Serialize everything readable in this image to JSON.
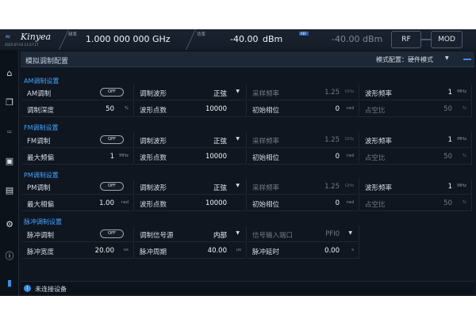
{
  "header": {
    "logo_text": "Kinyea",
    "date": "2025-07-03 11:57:17",
    "freq_label": "频率",
    "freq_value": "1.000 000 000",
    "freq_unit": "GHz",
    "power_label": "功率",
    "power_value": "-40.00",
    "power_unit": "dBm",
    "ref_badge": "REF",
    "power2_value": "-40.00 dBm",
    "rf_label": "RF",
    "mod_label": "MOD"
  },
  "sidebar": {
    "icons": [
      "home-icon",
      "window-icon",
      "scpi-icon",
      "monitor-icon",
      "document-icon",
      "gear-icon",
      "info-icon",
      "brand-icon"
    ]
  },
  "page": {
    "title": "模拟调制配置",
    "mode_label": "模式配置：硬件模式"
  },
  "am": {
    "title": "AM调制设置",
    "r1": {
      "c1": {
        "label": "AM调制",
        "toggle": "OFF"
      },
      "c2": {
        "label": "调制波形",
        "value": "正弦"
      },
      "c3": {
        "label": "采样频率",
        "value": "1.25",
        "unit": "GHz"
      },
      "c4": {
        "label": "波形频率",
        "value": "1",
        "unit": "MHz"
      }
    },
    "r2": {
      "c1": {
        "label": "调制深度",
        "value": "50",
        "unit": "%"
      },
      "c2": {
        "label": "波形点数",
        "value": "10000"
      },
      "c3": {
        "label": "初始相位",
        "value": "0",
        "unit": "rad"
      },
      "c4": {
        "label": "占空比",
        "value": "50",
        "unit": "%"
      }
    }
  },
  "fm": {
    "title": "FM调制设置",
    "r1": {
      "c1": {
        "label": "FM调制",
        "toggle": "OFF"
      },
      "c2": {
        "label": "调制波形",
        "value": "正弦"
      },
      "c3": {
        "label": "采样频率",
        "value": "1.25",
        "unit": "GHz"
      },
      "c4": {
        "label": "波形频率",
        "value": "1",
        "unit": "MHz"
      }
    },
    "r2": {
      "c1": {
        "label": "最大频偏",
        "value": "1",
        "unit": "MHz"
      },
      "c2": {
        "label": "波形点数",
        "value": "10000"
      },
      "c3": {
        "label": "初始相位",
        "value": "0",
        "unit": "rad"
      },
      "c4": {
        "label": "占空比",
        "value": "50",
        "unit": "%"
      }
    }
  },
  "pm": {
    "title": "PM调制设置",
    "r1": {
      "c1": {
        "label": "PM调制",
        "toggle": "OFF"
      },
      "c2": {
        "label": "调制波形",
        "value": "正弦"
      },
      "c3": {
        "label": "采样频率",
        "value": "1.25",
        "unit": "GHz"
      },
      "c4": {
        "label": "波形频率",
        "value": "1",
        "unit": "MHz"
      }
    },
    "r2": {
      "c1": {
        "label": "最大相偏",
        "value": "1.00",
        "unit": "rad"
      },
      "c2": {
        "label": "波形点数",
        "value": "10000"
      },
      "c3": {
        "label": "初始相位",
        "value": "0",
        "unit": "rad"
      },
      "c4": {
        "label": "占空比",
        "value": "50",
        "unit": "%"
      }
    }
  },
  "pulse": {
    "title": "脉冲调制设置",
    "r1": {
      "c1": {
        "label": "脉冲调制",
        "toggle": "OFF"
      },
      "c2": {
        "label": "调制信号源",
        "value": "内部"
      },
      "c3": {
        "label": "信号输入端口",
        "value": "PFI0"
      }
    },
    "r2": {
      "c1": {
        "label": "脉冲宽度",
        "value": "20.00",
        "unit": "us"
      },
      "c2": {
        "label": "脉冲周期",
        "value": "40.00",
        "unit": "us"
      },
      "c3": {
        "label": "脉冲延时",
        "value": "0.00",
        "unit": "s"
      }
    }
  },
  "status": {
    "text": "未连接设备"
  }
}
